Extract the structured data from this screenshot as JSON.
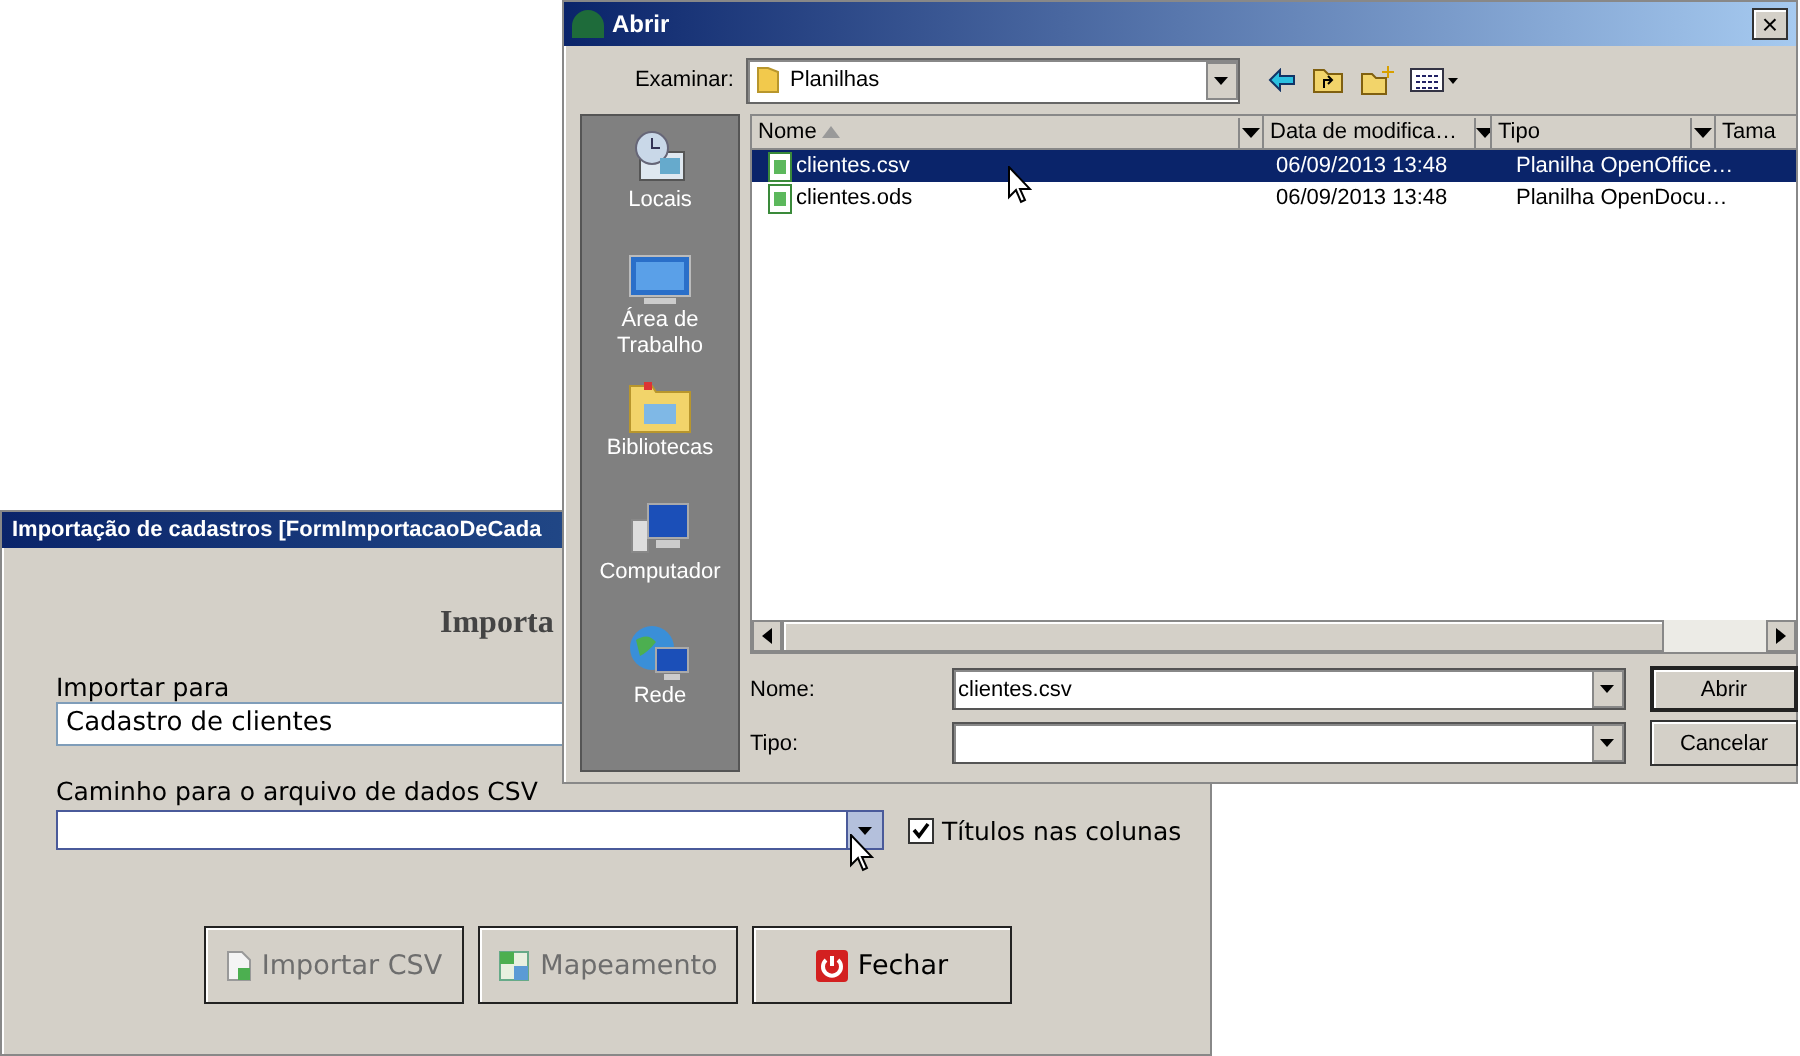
{
  "main_window": {
    "title": "Importação de cadastros [FormImportacaoDeCada",
    "heading": "Importa",
    "import_to": {
      "label": "Importar para",
      "value": "Cadastro de clientes"
    },
    "csv_path": {
      "label": "Caminho para o arquivo de dados CSV",
      "hover": true
    },
    "titles_checkbox": {
      "label": "Títulos nas colunas",
      "checked": true
    },
    "buttons": [
      {
        "label": "Importar CSV",
        "kind": "import",
        "disabled": true
      },
      {
        "label": "Mapeamento",
        "kind": "mapping",
        "disabled": true
      },
      {
        "label": "Fechar",
        "kind": "close",
        "disabled": false
      }
    ]
  },
  "dialog": {
    "title": "Abrir",
    "close": "×",
    "look_in": {
      "label": "Examinar:",
      "value": "Planilhas"
    },
    "places": [
      {
        "label": "Locais",
        "kind": "recent"
      },
      {
        "label": "Área de Trabalho",
        "kind": "desktop"
      },
      {
        "label": "Bibliotecas",
        "kind": "libraries"
      },
      {
        "label": "Computador",
        "kind": "computer"
      },
      {
        "label": "Rede",
        "kind": "network"
      }
    ],
    "columns": [
      {
        "label": "Nome",
        "sorted": true
      },
      {
        "label": "Data de modifica…",
        "sorted": false
      },
      {
        "label": "Tipo",
        "sorted": false
      },
      {
        "label": "Tama",
        "sorted": false
      }
    ],
    "files": [
      {
        "name": "clientes.csv",
        "date": "06/09/2013 13:48",
        "type": "Planilha OpenOffice…",
        "selected": true
      },
      {
        "name": "clientes.ods",
        "date": "06/09/2013 13:48",
        "type": "Planilha OpenDocu…",
        "selected": false
      }
    ],
    "name_field": {
      "label": "Nome:",
      "value": "clientes.csv"
    },
    "type_field": {
      "label": "Tipo:"
    },
    "buttons": [
      "Abrir",
      "Cancelar"
    ]
  }
}
